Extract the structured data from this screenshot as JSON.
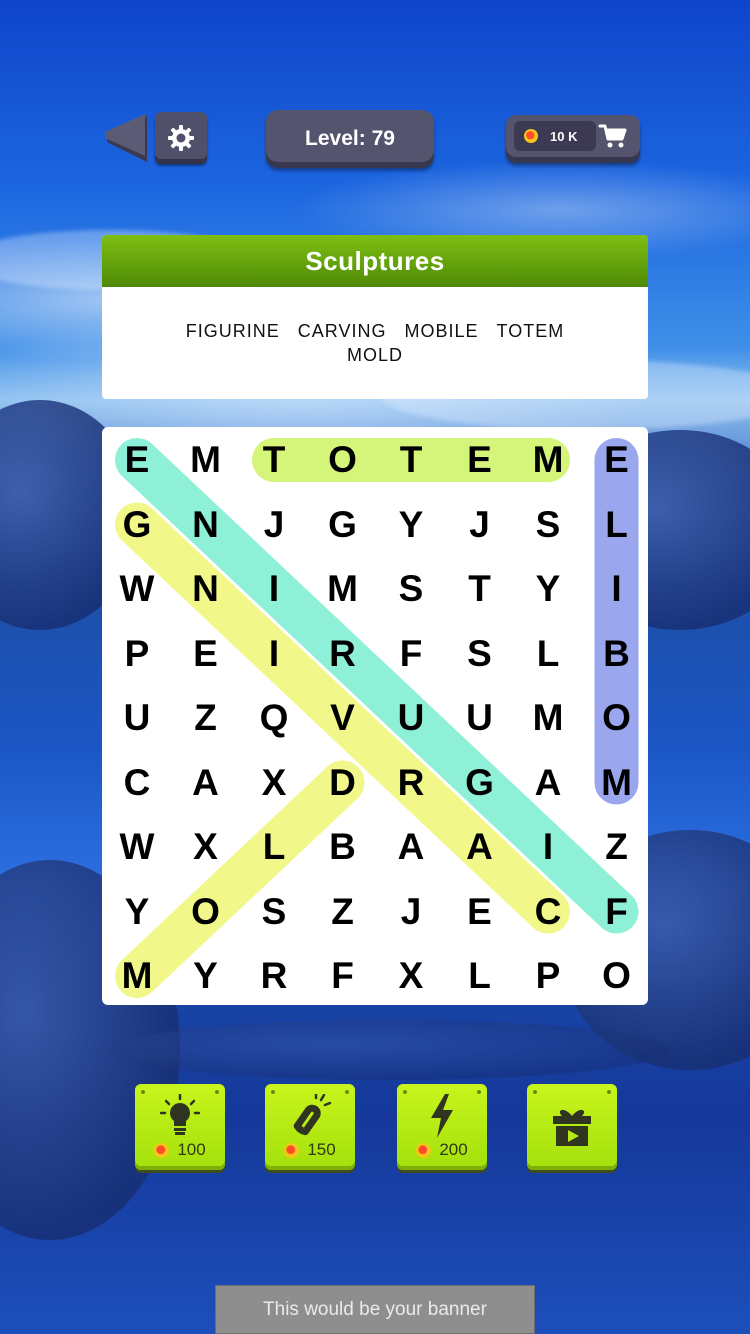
{
  "header": {
    "back_icon": "back-arrow-icon",
    "settings_icon": "gear-icon",
    "level_label": "Level: 79",
    "coins_label": "10 K",
    "cart_icon": "cart-icon"
  },
  "category": {
    "title": "Sculptures",
    "words": [
      "FIGURINE",
      "CARVING",
      "MOBILE",
      "TOTEM",
      "MOLD"
    ]
  },
  "grid": {
    "rows": [
      [
        "E",
        "M",
        "T",
        "O",
        "T",
        "E",
        "M",
        "E"
      ],
      [
        "G",
        "N",
        "J",
        "G",
        "Y",
        "J",
        "S",
        "L"
      ],
      [
        "W",
        "N",
        "I",
        "M",
        "S",
        "T",
        "Y",
        "I"
      ],
      [
        "P",
        "E",
        "I",
        "R",
        "F",
        "S",
        "L",
        "B"
      ],
      [
        "U",
        "Z",
        "Q",
        "V",
        "U",
        "U",
        "M",
        "O"
      ],
      [
        "C",
        "A",
        "X",
        "D",
        "R",
        "G",
        "A",
        "M"
      ],
      [
        "W",
        "X",
        "L",
        "B",
        "A",
        "A",
        "I",
        "Z"
      ],
      [
        "Y",
        "O",
        "S",
        "Z",
        "J",
        "E",
        "C",
        "F"
      ],
      [
        "M",
        "Y",
        "R",
        "F",
        "X",
        "L",
        "P",
        "O"
      ]
    ],
    "found_highlights": [
      {
        "word": "TOTEM",
        "from": [
          0,
          2
        ],
        "to": [
          0,
          6
        ],
        "color": "#d4f57a"
      },
      {
        "word": "MOBILE",
        "from": [
          5,
          7
        ],
        "to": [
          0,
          7
        ],
        "color": "#9aa6ee"
      },
      {
        "word": "FIGURINE",
        "from": [
          7,
          7
        ],
        "to": [
          0,
          0
        ],
        "color": "#8ef0d6"
      },
      {
        "word": "CARVING",
        "from": [
          7,
          6
        ],
        "to": [
          1,
          0
        ],
        "color": "#f2f78a"
      },
      {
        "word": "MOLD",
        "from": [
          8,
          0
        ],
        "to": [
          5,
          3
        ],
        "color": "#f2f78a"
      }
    ]
  },
  "powerups": [
    {
      "name": "hint",
      "icon": "lightbulb-icon",
      "price": "100"
    },
    {
      "name": "magnet",
      "icon": "magnet-icon",
      "price": "150"
    },
    {
      "name": "lightning",
      "icon": "lightning-icon",
      "price": "200"
    },
    {
      "name": "video-gift",
      "icon": "gift-video-icon",
      "price": ""
    }
  ],
  "banner": {
    "text": "This would be your banner"
  }
}
